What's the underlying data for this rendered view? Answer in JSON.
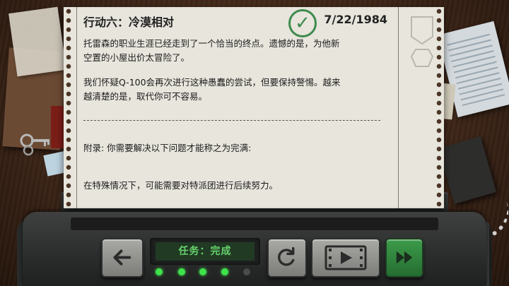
{
  "mission": {
    "title": "行动六：冷漠相对",
    "date": "7/22/1984",
    "status_icon": "check-mark",
    "paragraph_1_line_1": "托雷森的职业生涯已经走到了一个恰当的终点。遗憾的是，为他新",
    "paragraph_1_line_2": "空置的小屋出价太冒险了。",
    "paragraph_2_line_1": "我们怀疑Q-100会再次进行这种愚蠢的尝试，但要保持警惕。越来",
    "paragraph_2_line_2": "越清楚的是，取代你可不容易。",
    "appendix": "附录: 你需要解决以下问题才能称之为完满:",
    "note": "在特殊情况下，可能需要对特派团进行后续努力。"
  },
  "console": {
    "display_text": "任务：完成",
    "buttons": {
      "back_icon": "arrow-left",
      "replay_icon": "replay-circular-arrow",
      "play_icon": "film-play",
      "fast_forward_icon": "fast-forward"
    },
    "progress_leds": [
      1,
      1,
      1,
      1,
      0
    ]
  },
  "colors": {
    "accent_green": "#3e8a4e",
    "lcd_text": "#66d36c",
    "paper": "#e7e5dc"
  }
}
